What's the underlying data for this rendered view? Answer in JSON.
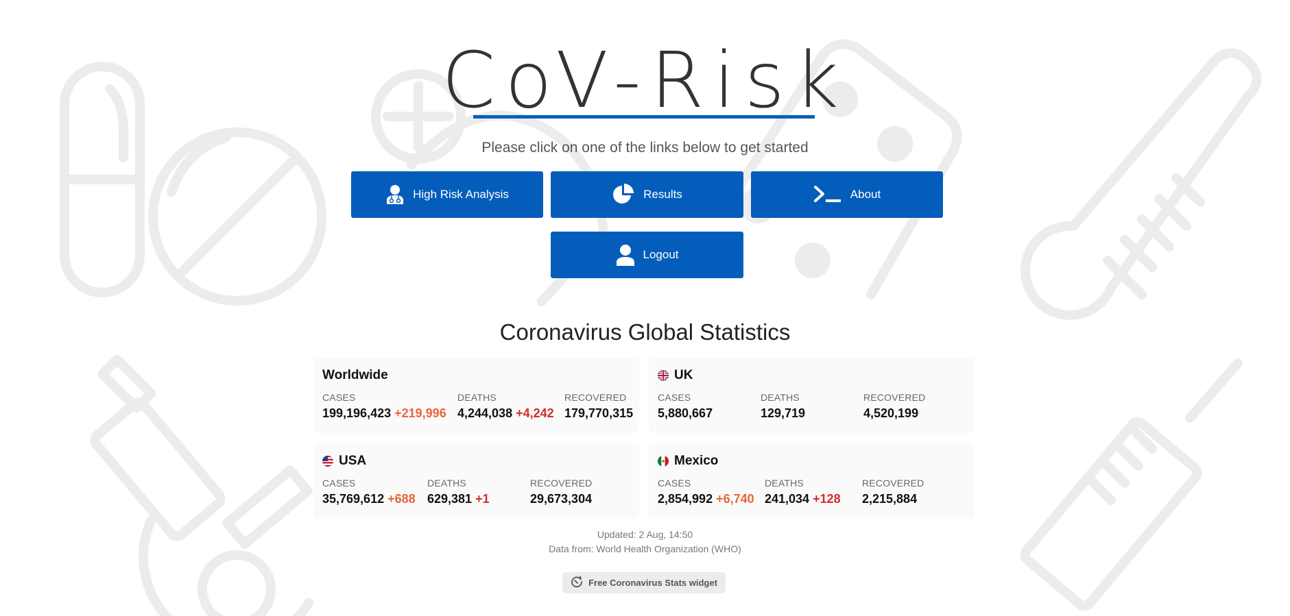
{
  "header": {
    "title": "CoV-Risk",
    "subtitle": "Please click on one of the links below to get started"
  },
  "nav": {
    "high_risk_label": "High Risk Analysis",
    "results_label": "Results",
    "about_label": "About",
    "logout_label": "Logout"
  },
  "stats": {
    "title": "Coronavirus Global Statistics",
    "labels": {
      "cases": "CASES",
      "deaths": "DEATHS",
      "recovered": "RECOVERED"
    },
    "worldwide": {
      "name": "Worldwide",
      "cases": "199,196,423",
      "cases_new": "+219,996",
      "deaths": "4,244,038",
      "deaths_new": "+4,242",
      "recovered": "179,770,315"
    },
    "uk": {
      "name": "UK",
      "cases": "5,880,667",
      "deaths": "129,719",
      "recovered": "4,520,199"
    },
    "usa": {
      "name": "USA",
      "cases": "35,769,612",
      "cases_new": "+688",
      "deaths": "629,381",
      "deaths_new": "+1",
      "recovered": "29,673,304"
    },
    "mexico": {
      "name": "Mexico",
      "cases": "2,854,992",
      "cases_new": "+6,740",
      "deaths": "241,034",
      "deaths_new": "+128",
      "recovered": "2,215,884"
    },
    "updated": "Updated: 2 Aug, 14:50",
    "source": "Data from: World Health Organization (WHO)",
    "widget_label": "Free Coronavirus Stats widget"
  },
  "colors": {
    "button": "#055dbb",
    "underline": "#0d5fb8",
    "increase_cases": "#e8653a",
    "increase_deaths": "#d62a2a"
  },
  "icons": [
    "doctor-icon",
    "pie-chart-icon",
    "terminal-icon",
    "user-icon",
    "refresh-icon"
  ]
}
